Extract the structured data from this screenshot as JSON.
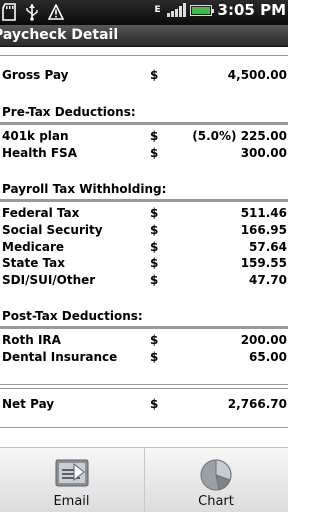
{
  "status_bar": {
    "time": "3:05",
    "time_suffix": "PM",
    "network_indicator": "E",
    "icons": [
      "sd-card-icon",
      "usb-icon",
      "warning-icon",
      "signal-icon",
      "battery-icon"
    ],
    "battery_color": "#3fbf3f"
  },
  "title": "Paycheck Detail",
  "currency_symbol": "$",
  "gross": {
    "label": "Gross Pay",
    "amount": "4,500.00"
  },
  "pretax": {
    "heading": "Pre-Tax Deductions:",
    "items": [
      {
        "label": "401k plan",
        "amount": "(5.0%) 225.00"
      },
      {
        "label": "Health FSA",
        "amount": "300.00"
      }
    ]
  },
  "payroll": {
    "heading": "Payroll Tax Withholding:",
    "items": [
      {
        "label": "Federal Tax",
        "amount": "511.46"
      },
      {
        "label": "Social Security",
        "amount": "166.95"
      },
      {
        "label": "Medicare",
        "amount": "57.64"
      },
      {
        "label": "State Tax",
        "amount": "159.55"
      },
      {
        "label": "SDI/SUI/Other",
        "amount": "47.70"
      }
    ]
  },
  "posttax": {
    "heading": "Post-Tax Deductions:",
    "items": [
      {
        "label": "Roth IRA",
        "amount": "200.00"
      },
      {
        "label": "Dental Insurance",
        "amount": "65.00"
      }
    ]
  },
  "net": {
    "label": "Net Pay",
    "amount": "2,766.70"
  },
  "bottom_bar": {
    "email_label": "Email",
    "chart_label": "Chart"
  }
}
